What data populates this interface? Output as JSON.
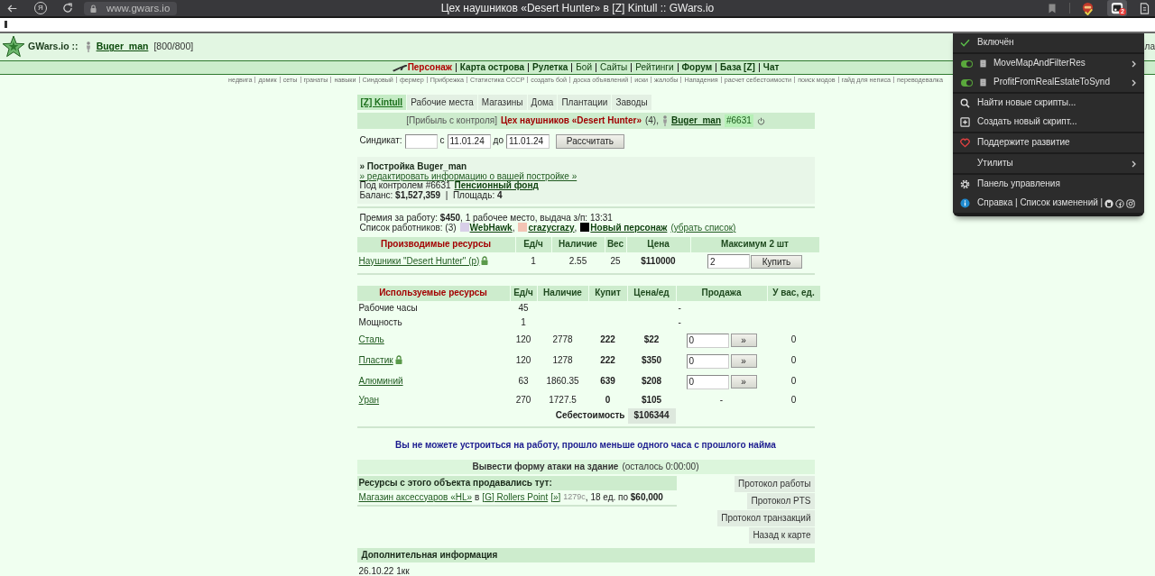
{
  "browser": {
    "yandex": "Я",
    "url": "www.gwars.io",
    "title": "Цех наушников «Desert Hunter» в [Z] Kintull :: GWars.io",
    "extension_badge": "2"
  },
  "header": {
    "site": "GWars.io ::",
    "user": "Buger_man",
    "health": "[800/800]",
    "right_text": "ла"
  },
  "nav": {
    "links": [
      {
        "label": "Персонаж",
        "bold": true,
        "highlighted": true
      },
      {
        "label": "Карта острова",
        "bold": true,
        "highlighted": false
      },
      {
        "label": "Рулетка",
        "bold": true,
        "highlighted": false
      },
      {
        "label": "Бой",
        "bold": false,
        "highlighted": false
      },
      {
        "label": "Сайты",
        "bold": false,
        "highlighted": false
      },
      {
        "label": "Рейтинги",
        "bold": false,
        "highlighted": false
      },
      {
        "label": "Форум",
        "bold": true,
        "highlighted": false
      },
      {
        "label": "База [Z]",
        "bold": true,
        "highlighted": false
      },
      {
        "label": "Чат",
        "bold": true,
        "highlighted": false
      }
    ],
    "sublinks": [
      "недвига",
      "домик",
      "сеты",
      "гранаты",
      "навыки",
      "Синдовый",
      "фермер",
      "Прибрежка",
      "Статистика СССР",
      "создать бой",
      "доска объявлений",
      "иски",
      "жалобы",
      "Нападения",
      "расчет себестоимости",
      "поиск модов",
      "гайд для неписа",
      "переводевалка"
    ]
  },
  "menu": {
    "sections": [
      [
        {
          "kind": "status",
          "label": "Включён",
          "checked": true
        }
      ],
      [
        {
          "kind": "script",
          "label": "MoveMapAndFilterRes",
          "on": true
        },
        {
          "kind": "script",
          "label": "ProfitFromRealEstateToSynd",
          "on": true
        }
      ],
      [
        {
          "kind": "search",
          "label": "Найти новые скрипты..."
        },
        {
          "kind": "create",
          "label": "Создать новый скрипт..."
        }
      ],
      [
        {
          "kind": "donate",
          "label": "Поддержите развитие"
        }
      ],
      [
        {
          "kind": "submenu",
          "label": "Утилиты"
        }
      ],
      [
        {
          "kind": "settings",
          "label": "Панель управления"
        },
        {
          "kind": "help",
          "label": "Справка | Список изменений |"
        }
      ]
    ]
  },
  "tabs": [
    {
      "label": "[Z] Kintull",
      "selected": true
    },
    {
      "label": "Рабочие места",
      "selected": false
    },
    {
      "label": "Магазины",
      "selected": false
    },
    {
      "label": "Дома",
      "selected": false
    },
    {
      "label": "Плантации",
      "selected": false
    },
    {
      "label": "Заводы",
      "selected": false
    }
  ],
  "title_bar": {
    "tag": "[Прибыль с контроля]",
    "building": "Цех наушников «Desert Hunter»",
    "count": "(4),",
    "owner": "Buger_man",
    "number": "#6631"
  },
  "calc_form": {
    "syndicate_label": "Синдикат:",
    "from_label": "с",
    "from": "11.01.24",
    "to_label": "до",
    "to": "11.01.24",
    "button": "Рассчитать"
  },
  "info": {
    "heading": "» Постройка Buger_man",
    "edit_link": "» редактировать информацию о вашей постройке »",
    "control_text": "Под контролем #6631",
    "fund_link": "Пенсионный фонд",
    "balance": "Баланс: **$1,527,359**  |  Площадь: **4**"
  },
  "workers": {
    "bonus": "Премия за работу: **$450**, 1 рабочее место, выдача з/п: 13:31",
    "label": "Список работников: (3)",
    "list": [
      {
        "name": "WebHawk",
        "color": "#d8cfe8",
        "after": ","
      },
      {
        "name": "crazycrazy",
        "color": "#f3c4b4",
        "after": ","
      },
      {
        "name": "Новый персонаж",
        "color": "#000000"
      }
    ],
    "hide_link": "(убрать список)"
  },
  "produced": {
    "columns": [
      "Производимые ресурсы",
      "Ед/ч",
      "Наличие",
      "Вес",
      "Цена",
      "Максимум **2 шт**"
    ],
    "rows": [
      {
        "name": "Наушники \"Desert Hunter\" (р)",
        "locked": true,
        "per_hour": "1",
        "stock": "2.55",
        "weight": "25",
        "price": "$110000",
        "quantity": "2",
        "button": "Купить"
      }
    ]
  },
  "used": {
    "columns": [
      "Используемые ресурсы",
      "Ед/ч",
      "Наличие",
      "Купит",
      "Цена/ед",
      "Продажа",
      "У вас, ед."
    ],
    "rows": [
      {
        "kind": "plain",
        "name": "Рабочие часы",
        "per_hour": "45",
        "sale": "-"
      },
      {
        "kind": "plain",
        "name": "Мощность",
        "per_hour": "1",
        "sale": "-"
      },
      {
        "kind": "trade",
        "name": "Сталь",
        "per_hour": "120",
        "stock": "2778",
        "buy": "222",
        "price": "$22",
        "quantity": "0",
        "button": "»",
        "yours": "0"
      },
      {
        "kind": "trade",
        "name": "Пластик",
        "locked": true,
        "per_hour": "120",
        "stock": "1278",
        "buy": "222",
        "price": "$350",
        "quantity": "0",
        "button": "»",
        "yours": "0"
      },
      {
        "kind": "trade",
        "name": "Алюминий",
        "per_hour": "63",
        "stock": "1860.35",
        "buy": "639",
        "price": "$208",
        "quantity": "0",
        "button": "»",
        "yours": "0"
      },
      {
        "kind": "resource",
        "name": "Уран",
        "per_hour": "270",
        "stock": "1727.5",
        "buy": "0",
        "price": "$105",
        "sale": "-",
        "yours": "0"
      }
    ],
    "total": {
      "label": "Себестоимость",
      "value": "$106344"
    }
  },
  "notice": "Вы не можете устроиться на работу, прошло меньше одного часа с прошлого найма",
  "attack": {
    "link": "Вывести форму атаки на здание",
    "remaining": "(осталось 0:00:00)"
  },
  "sales": {
    "heading": "Ресурсы с этого объекта продавались тут:",
    "entries": [
      {
        "shop": "Магазин аксессуаров «HL»",
        "in": "в",
        "location": "[G] Rollers Point",
        "go": "[»]",
        "code": "1279с",
        "details": ", 18 ед. по **$60,000**"
      }
    ]
  },
  "actions": [
    "Протокол работы",
    "Протокол PTS",
    "Протокол транзакций",
    "Назад к карте"
  ],
  "extra": {
    "heading": "Дополнительная информация",
    "text": "26.10.22 1кк"
  }
}
